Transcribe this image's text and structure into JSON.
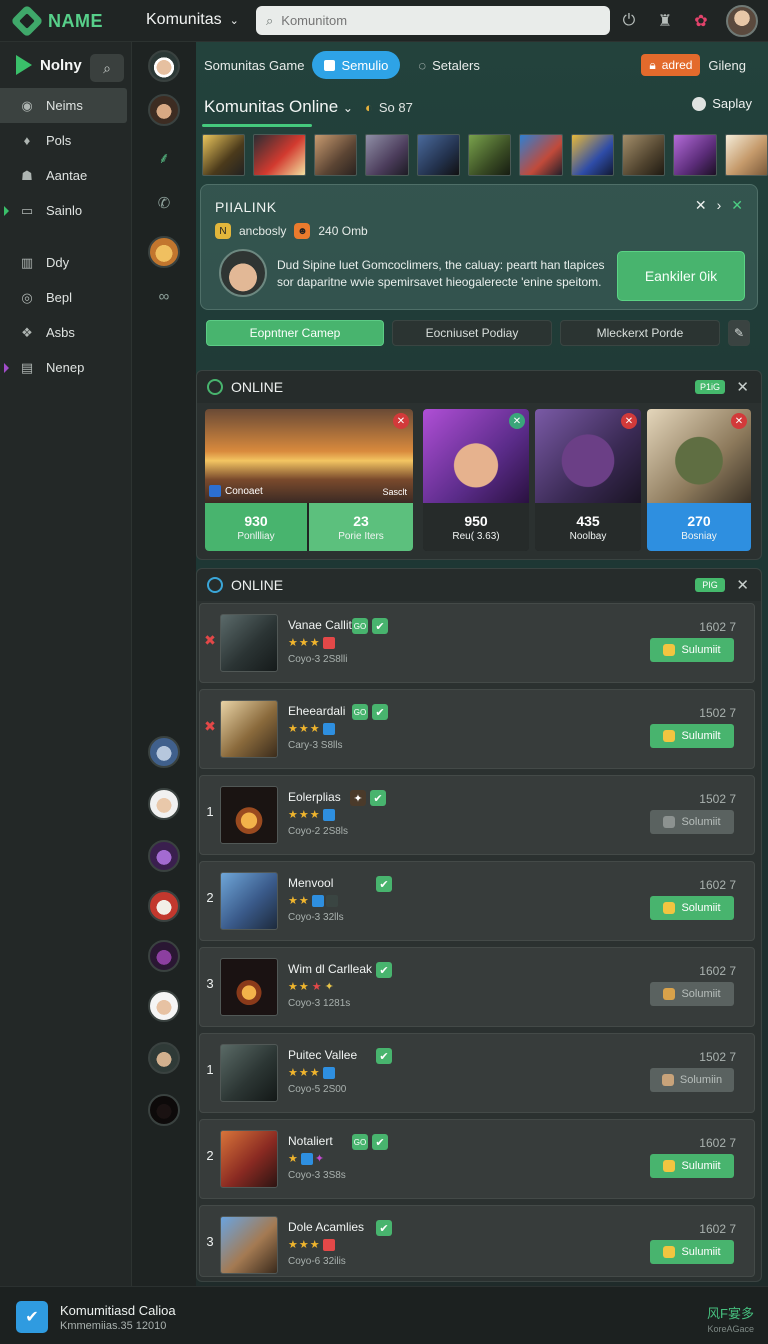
{
  "app": {
    "name": "NAME",
    "workspace": "Komunitas",
    "search_placeholder": "Komunitom"
  },
  "top_icons": [
    "power-icon",
    "bell-icon",
    "notification-flower-icon",
    "user-avatar"
  ],
  "leftnav": {
    "title": "Nolny",
    "items": [
      {
        "label": "Neims",
        "icon": "circle-icon",
        "active": true
      },
      {
        "label": "Pols",
        "icon": "drop-icon"
      },
      {
        "label": "Aantae",
        "icon": "users-icon"
      },
      {
        "label": "Sainlo",
        "icon": "doc-icon",
        "marker": "green"
      },
      {
        "label": "Ddy",
        "icon": "grid-icon"
      },
      {
        "label": "Bepl",
        "icon": "target-icon"
      },
      {
        "label": "Asbs",
        "icon": "puzzle-icon"
      },
      {
        "label": "Nenep",
        "icon": "bars-icon",
        "marker": "purple"
      }
    ]
  },
  "tabs": {
    "t1": "Somunitas Game",
    "t2": "Semulio",
    "t3": "Setalers",
    "t4": "adred",
    "t5": "Gileng"
  },
  "community": {
    "title": "Komunitas Online",
    "count": "So 87",
    "display": "Saplay"
  },
  "feature": {
    "title": "PIIALINK",
    "meta1": "ancbosly",
    "meta2": "240 Omb",
    "description": "Dud Sipine luet Gomcoclimers, the caluay: peartt han tlapices sor daparitne wvie spemirsavet hieogalerecte 'enine speitom.",
    "button": "Eankiler 0ik"
  },
  "actions": {
    "a1": "Eopntner Camep",
    "a2": "Eocniuset Podiay",
    "a3": "Mleckerxt Porde"
  },
  "online_cards": {
    "header": "ONLINE",
    "badge": "P1iG",
    "cards": [
      {
        "caption": "Conoaet",
        "stat1": "930",
        "label1": "Ponllliay",
        "stat2": "23",
        "label2": "Porie Iters",
        "tag": "Sasclt"
      },
      {
        "stat": "950",
        "label": "Reu( 3.63)"
      },
      {
        "stat": "435",
        "label": "Noolbay"
      },
      {
        "stat": "270",
        "label": "Bosniay"
      }
    ]
  },
  "list": {
    "header": "ONLINE",
    "badge": "PIG",
    "rows": [
      {
        "rank": "✖",
        "name": "Vanae Callite",
        "sub": "Coyo-3 2S8lli",
        "count": "1602  7",
        "btn": "Sulumiit",
        "active": true
      },
      {
        "rank": "✖",
        "name": "Eheeardali",
        "sub": "Cary-3 S8lls",
        "count": "1502  7",
        "btn": "Sulumilt",
        "active": true
      },
      {
        "rank": "1",
        "name": "Eolerplias",
        "sub": "Coyo-2 2S8ls",
        "count": "1502  7",
        "btn": "Solumiit",
        "active": false
      },
      {
        "rank": "2",
        "name": "Menvool",
        "sub": "Coyo-3 32lls",
        "count": "1602  7",
        "btn": "Solumiit",
        "active": true
      },
      {
        "rank": "3",
        "name": "Wim dl Carlleak",
        "sub": "Coyo-3 1281s",
        "count": "1602  7",
        "btn": "Solumiit",
        "active": false
      },
      {
        "rank": "1",
        "name": "Puitec Vallee",
        "sub": "Coyo-5 2S00",
        "count": "1502  7",
        "btn": "Solumiin",
        "active": false
      },
      {
        "rank": "2",
        "name": "Notaliert",
        "sub": "Coyo-3 3S8s",
        "count": "1602  7",
        "btn": "Sulumiit",
        "active": true
      },
      {
        "rank": "3",
        "name": "Dole Acamlies",
        "sub": "Coyo-6 32ilis",
        "count": "1602  7",
        "btn": "Sulumiit",
        "active": true
      }
    ]
  },
  "footer": {
    "title": "Komumitiasd Calioa",
    "sub": "Kmmemiias.35 12010",
    "right": "风F宴多",
    "right_sub": "KoreAGace"
  },
  "colors": {
    "accent_green": "#48b46e",
    "accent_blue": "#2ea3e6",
    "accent_orange": "#e36a2c",
    "bg_dark": "#1e2322"
  }
}
